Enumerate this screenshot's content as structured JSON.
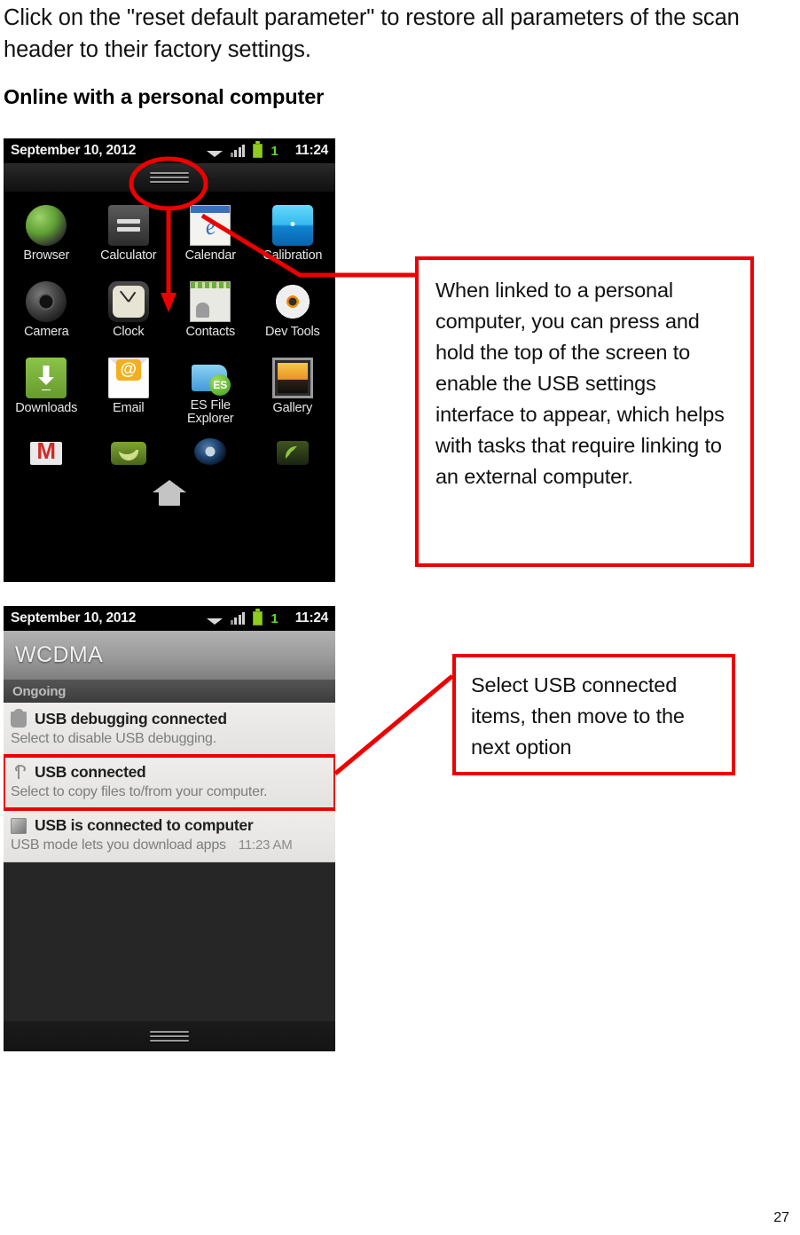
{
  "document": {
    "paragraph": "Click on the \"reset default parameter\" to restore all parameters of the scan header to their factory settings.",
    "heading": "Online with a personal computer",
    "page_number": "27"
  },
  "annotations": {
    "accent_color": "#ee0000",
    "callout_1": "When linked to a personal computer, you can press and hold the top of the screen to enable the USB settings interface to appear, which helps with tasks that require linking to an external computer.",
    "callout_2": "Select USB connected items, then move to the next option"
  },
  "screenshot_home": {
    "status_bar": {
      "date": "September 10, 2012",
      "time": "11:24",
      "notification_count": "1",
      "icons": [
        "wifi-icon",
        "signal-icon",
        "battery-icon"
      ]
    },
    "apps": [
      {
        "label": "Browser",
        "icon": "browser-icon"
      },
      {
        "label": "Calculator",
        "icon": "calculator-icon"
      },
      {
        "label": "Calendar",
        "icon": "calendar-icon"
      },
      {
        "label": "Calibration",
        "icon": "calibration-icon"
      },
      {
        "label": "Camera",
        "icon": "camera-icon"
      },
      {
        "label": "Clock",
        "icon": "clock-icon"
      },
      {
        "label": "Contacts",
        "icon": "contacts-icon"
      },
      {
        "label": "Dev Tools",
        "icon": "dev-tools-icon"
      },
      {
        "label": "Downloads",
        "icon": "downloads-icon"
      },
      {
        "label": "Email",
        "icon": "email-icon"
      },
      {
        "label": "ES File Explorer",
        "icon": "es-file-explorer-icon"
      },
      {
        "label": "Gallery",
        "icon": "gallery-icon"
      }
    ],
    "partial_row_icons": [
      "gmail-icon",
      "messaging-icon",
      "music-icon",
      "phone-icon"
    ],
    "home_button": "home-icon",
    "drag_handle": "drag-handle"
  },
  "screenshot_shade": {
    "status_bar": {
      "date": "September 10, 2012",
      "time": "11:24",
      "notification_count": "1"
    },
    "carrier": "WCDMA",
    "section_label": "Ongoing",
    "notifications": [
      {
        "title": "USB debugging connected",
        "subtitle": "Select to disable USB debugging.",
        "time": "",
        "icon": "usb-debug-icon",
        "highlighted": false
      },
      {
        "title": "USB connected",
        "subtitle": "Select to copy files to/from your computer.",
        "time": "",
        "icon": "usb-icon",
        "highlighted": true
      },
      {
        "title": "USB is connected to computer",
        "subtitle": "USB mode lets you download apps",
        "time": "11:23 AM",
        "icon": "sdcard-icon",
        "highlighted": false
      }
    ]
  }
}
